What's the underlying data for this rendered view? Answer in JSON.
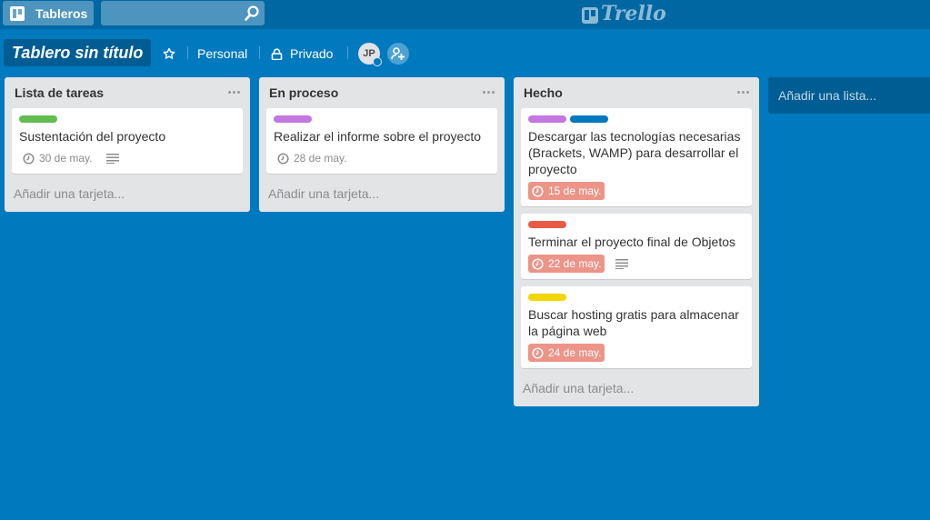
{
  "header": {
    "boards_label": "Tableros",
    "search": {
      "value": "",
      "placeholder": ""
    },
    "logo_text": "Trello",
    "boards_icon": "board-icon",
    "search_icon": "magnifier-icon"
  },
  "board": {
    "title": "Tablero sin título",
    "star_icon": "star-outline-icon",
    "team_label": "Personal",
    "visibility_label": "Privado",
    "visibility_icon": "lock-icon",
    "member_initials": "JP",
    "add_member_icon": "add-member-icon"
  },
  "colors": {
    "board_bg": "#0079bf",
    "header_bg": "#0067a3",
    "list_bg": "#e2e4e6",
    "label_green": "#61bd4f",
    "label_purple": "#c377e0",
    "label_blue": "#0079bf",
    "label_red": "#eb5a46",
    "label_yellow": "#f2d600",
    "overdue": "#ec9488"
  },
  "lists": [
    {
      "title": "Lista de tareas",
      "add_card": "Añadir una tarjeta...",
      "cards": [
        {
          "title": "Sustentación del proyecto",
          "labels": [
            "green"
          ],
          "due": "30 de may.",
          "overdue": false,
          "has_description": true
        }
      ]
    },
    {
      "title": "En proceso",
      "add_card": "Añadir una tarjeta...",
      "cards": [
        {
          "title": "Realizar el informe sobre el proyecto",
          "labels": [
            "purple"
          ],
          "due": "28 de may.",
          "overdue": false,
          "has_description": false
        }
      ]
    },
    {
      "title": "Hecho",
      "add_card": "Añadir una tarjeta...",
      "cards": [
        {
          "title": "Descargar las tecnologías necesarias (Brackets, WAMP) para desarrollar el proyecto",
          "labels": [
            "purple",
            "blue"
          ],
          "due": "15 de may.",
          "overdue": true,
          "has_description": false
        },
        {
          "title": "Terminar el proyecto final de Objetos",
          "labels": [
            "red"
          ],
          "due": "22 de may.",
          "overdue": true,
          "has_description": true
        },
        {
          "title": "Buscar hosting gratis para almacenar la página web",
          "labels": [
            "yellow"
          ],
          "due": "24 de may.",
          "overdue": true,
          "has_description": false
        }
      ]
    }
  ],
  "add_list_label": "Añadir una lista..."
}
